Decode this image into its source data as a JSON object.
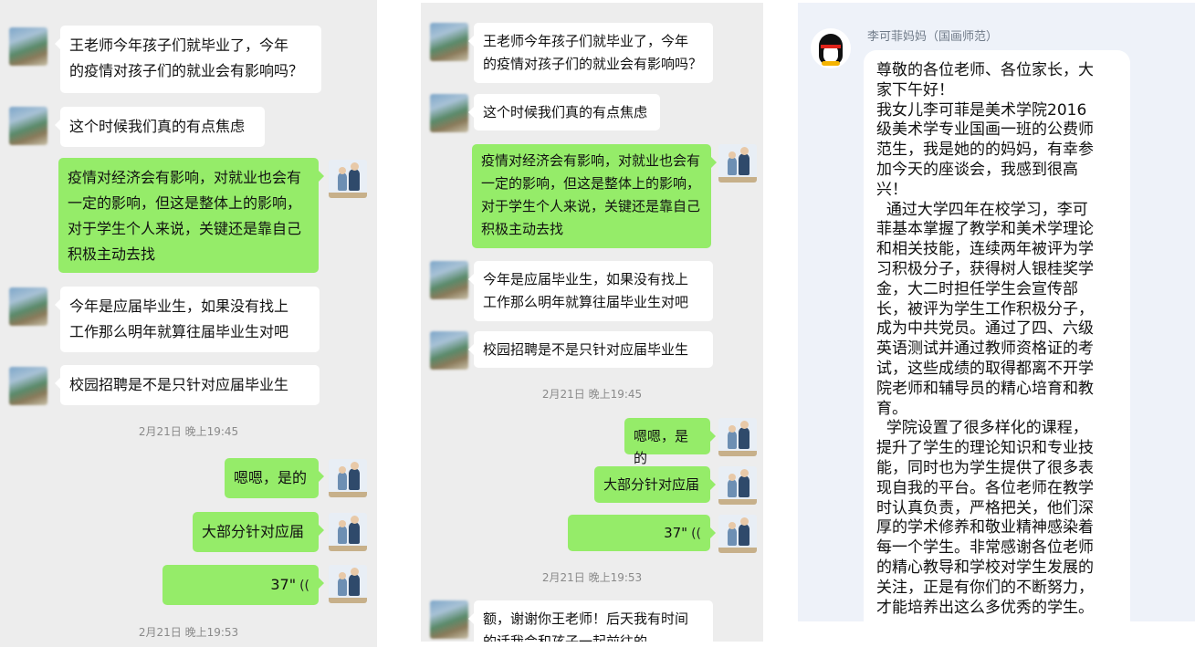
{
  "panel1": {
    "messages": [
      {
        "text": "王老师今年孩子们就毕业了，今年\n的疫情对孩子们的就业会有影响吗？"
      },
      {
        "text": "这个时候我们真的有点焦虑"
      },
      {
        "text": "疫情对经济会有影响，对就业也会有\n一定的影响，但这是整体上的影响，\n对于学生个人来说，关键还是靠自己\n积极主动去找"
      },
      {
        "text": "今年是应届毕业生，如果没有找上\n工作那么明年就算往届毕业生对吧"
      },
      {
        "text": "校园招聘是不是只针对应届毕业生"
      },
      {
        "timestamp": "2月21日 晚上19:45"
      },
      {
        "text": "嗯嗯，是的"
      },
      {
        "text": "大部分针对应届"
      },
      {
        "voice": "37\""
      },
      {
        "timestamp": "2月21日 晚上19:53"
      }
    ]
  },
  "panel2": {
    "messages": [
      {
        "text": "王老师今年孩子们就毕业了，今年\n的疫情对孩子们的就业会有影响吗？"
      },
      {
        "text": "这个时候我们真的有点焦虑"
      },
      {
        "text": "疫情对经济会有影响，对就业也会有\n一定的影响，但这是整体上的影响，\n对于学生个人来说，关键还是靠自己\n积极主动去找"
      },
      {
        "text": "今年是应届毕业生，如果没有找上\n工作那么明年就算往届毕业生对吧"
      },
      {
        "text": "校园招聘是不是只针对应届毕业生"
      },
      {
        "timestamp": "2月21日 晚上19:45"
      },
      {
        "text": "嗯嗯，是的"
      },
      {
        "text": "大部分针对应届"
      },
      {
        "voice": "37\""
      },
      {
        "timestamp": "2月21日 晚上19:53"
      },
      {
        "text": "额，谢谢你王老师！后天我有时间\n的话我会和孩子一起前往的"
      }
    ]
  },
  "panel3": {
    "sender": "李可菲妈妈（国画师范）",
    "message": "尊敬的各位老师、各位家长，大\n家下午好！\n我女儿李可菲是美术学院2016\n级美术学专业国画一班的公费师\n范生，我是她的的妈妈，有幸参\n加今天的座谈会，我感到很高\n兴！\n  通过大学四年在校学习，李可\n菲基本掌握了教学和美术学理论\n和相关技能，连续两年被评为学\n习积极分子，获得树人银桂奖学\n金，大二时担任学生会宣传部\n长，被评为学生工作积极分子，\n成为中共党员。通过了四、六级\n英语测试并通过教师资格证的考\n试，这些成绩的取得都离不开学\n院老师和辅导员的精心培育和教\n育。\n  学院设置了很多样化的课程，\n提升了学生的理论知识和专业技\n能，同时也为学生提供了很多表\n现自我的平台。各位老师在教学\n时认真负责，严格把关，他们深\n厚的学术修养和敬业精神感染着\n每一个学生。非常感谢各位老师\n的精心教导和学校对学生发展的\n关注，正是有你们的不断努力，\n才能培养出这么多优秀的学生。"
  },
  "icons": {
    "voice": "((",
    "avatar_qq": "penguin-icon"
  },
  "colors": {
    "chat_bg": "#ededed",
    "bubble_out": "#95ec69",
    "bubble_in": "#ffffff",
    "qq_bg": "#eef2f9"
  }
}
